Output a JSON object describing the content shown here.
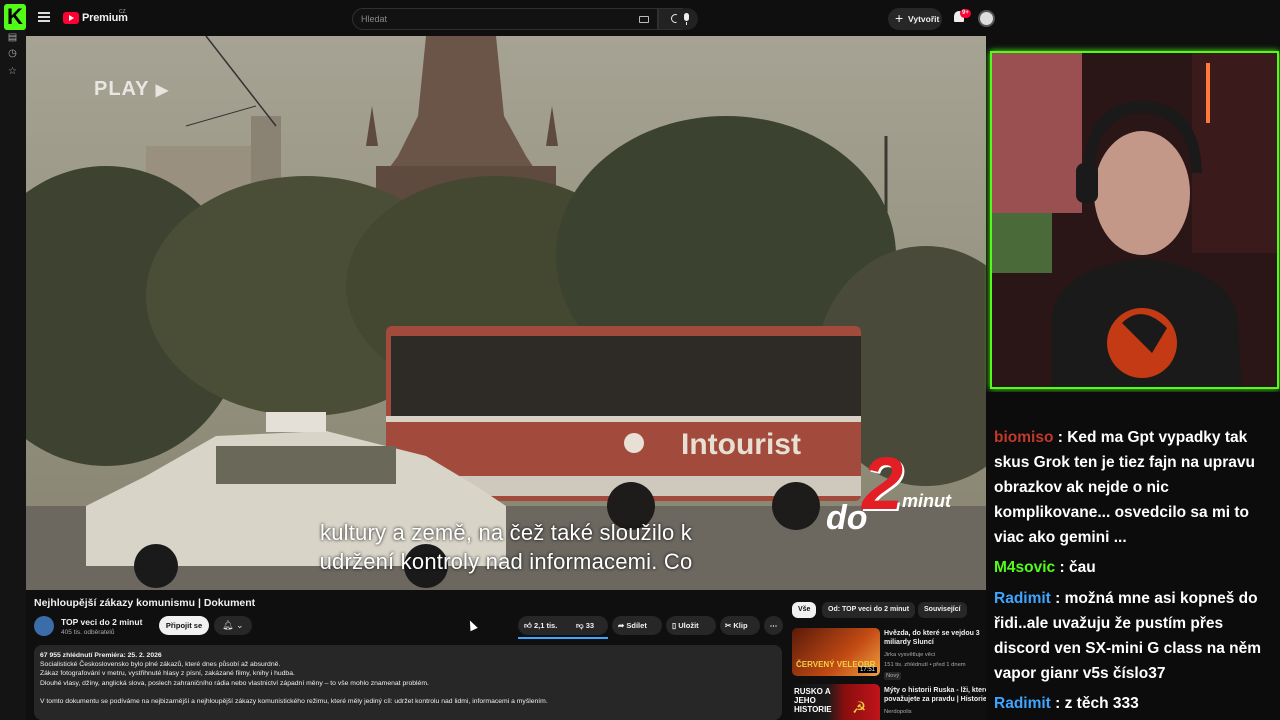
{
  "header": {
    "brand": "Premium",
    "brand_region": "CZ",
    "search_placeholder": "Hledat",
    "create_label": "Vytvořit",
    "notification_count": "9+"
  },
  "video": {
    "watermark": "PLAY",
    "caption_line1": "kultury a země, na čež také sloužilo k",
    "caption_line2": "udržení kontroly nad informacemi. Co",
    "bus_text": "Intourist",
    "logo_do": "do",
    "logo_2": "2",
    "logo_minut": "minut",
    "title": "Nejhloupější zákazy komunismu | Dokument"
  },
  "channel": {
    "name": "TOP veci do 2 minut",
    "subscribers": "405 tis. odběratelů",
    "subscribe_label": "Připojit se"
  },
  "actions": {
    "likes": "2,1 tis.",
    "dislikes": "33",
    "share": "Sdílet",
    "save": "Uložit",
    "clip": "Klip"
  },
  "description": {
    "stats": "67 955 zhlédnutí  Premiéra: 25. 2. 2026",
    "line1": "Socialistické Československo bylo plné zákazů, které dnes působí až absurdně.",
    "line2": "Zákaz fotografování v metru, vystřihnuté hlasy z písní, zakázané filmy, knihy i hudba.",
    "line3": "Dlouhé vlasy, džíny, anglická slova, poslech zahraničního rádia nebo vlastnictví západní měny – to vše mohlo znamenat problém.",
    "line4": "V tomto dokumentu se podíváme na nejbizarnější a nejhloupější zákazy komunistického režimu, které měly jediný cíl: udržet kontrolu nad lidmi, informacemi a myšlením."
  },
  "chips": [
    "Vše",
    "Od: TOP veci do 2 minut",
    "Související"
  ],
  "recommendations": [
    {
      "title": "Hvězda, do které se vejdou 3 miliardy Sluncí",
      "channel": "Jirka vysvětluje věci",
      "meta": "151 tis. zhlédnutí • před 1 dnem",
      "badge": "Nový",
      "duration": "17:51",
      "thumb_text": "ČERVENÝ VELEOBR"
    },
    {
      "title": "Mýty o historii Ruska - lži, které považujete za pravdu | Historie",
      "channel": "Nerdopolis",
      "meta": "",
      "badge": "",
      "duration": "",
      "thumb_text": "RUSKO A JEHO HISTORIE"
    }
  ],
  "chat": [
    {
      "user": "biomiso",
      "user_color": "#c0392b",
      "text": "Ked ma Gpt vypadky tak skus Grok ten je tiez fajn na upravu obrazkov ak nejde o nic komplikovane... osvedcilo sa mi to viac ako gemini ..."
    },
    {
      "user": "M4sovic",
      "user_color": "#53fc18",
      "text": "čau"
    },
    {
      "user": "Radimit",
      "user_color": "#3ea6ff",
      "text": "možná mne asi kopneš do řidi..ale uvažuju že pustím přes discord ven SX-mini G class na něm vapor gianr v5s číslo37"
    },
    {
      "user": "Radimit",
      "user_color": "#3ea6ff",
      "text": "z těch 333"
    }
  ],
  "colors": {
    "kick_green": "#53fc18",
    "youtube_red": "#ff0033",
    "progress_blue": "#3ea6ff"
  }
}
